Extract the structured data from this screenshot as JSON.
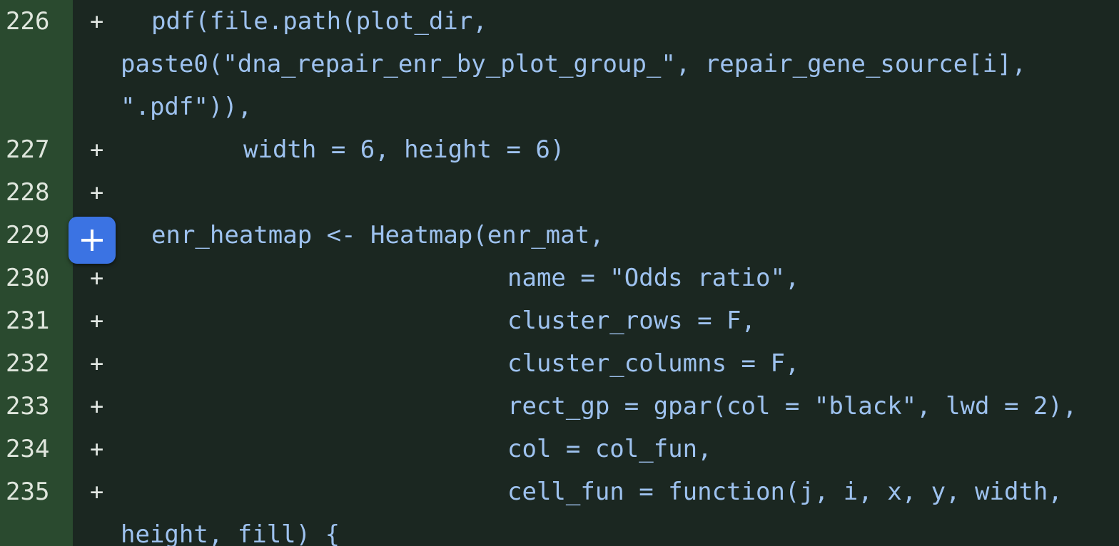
{
  "diff": {
    "add_marker": "+",
    "lines": [
      {
        "num": "226",
        "code": "  pdf(file.path(plot_dir, paste0(\"dna_repair_enr_by_plot_group_\", repair_gene_source[i], \".pdf\")),",
        "display": [
          "pdf(file.path(plot_dir,",
          "paste0(\"dna_repair_enr_by_plot_group_\", repair_gene_source[i],",
          "\".pdf\")),"
        ]
      },
      {
        "num": "227",
        "code": "        width = 6, height = 6)"
      },
      {
        "num": "228",
        "code": ""
      },
      {
        "num": "229",
        "code": "  enr_heatmap <- Heatmap(enr_mat,"
      },
      {
        "num": "230",
        "code": "                         name = \"Odds ratio\","
      },
      {
        "num": "231",
        "code": "                         cluster_rows = F,"
      },
      {
        "num": "232",
        "code": "                         cluster_columns = F,"
      },
      {
        "num": "233",
        "code": "                         rect_gp = gpar(col = \"black\", lwd = 2),"
      },
      {
        "num": "234",
        "code": "                         col = col_fun,"
      },
      {
        "num": "235",
        "code": "                         cell_fun = function(j, i, x, y, width, height, fill) {",
        "display": [
          "cell_fun = function(j, i, x, y, width,",
          "height, fill) {"
        ]
      }
    ]
  },
  "add_comment_button": {
    "icon": "plus-icon",
    "color": "#3b73e3"
  }
}
